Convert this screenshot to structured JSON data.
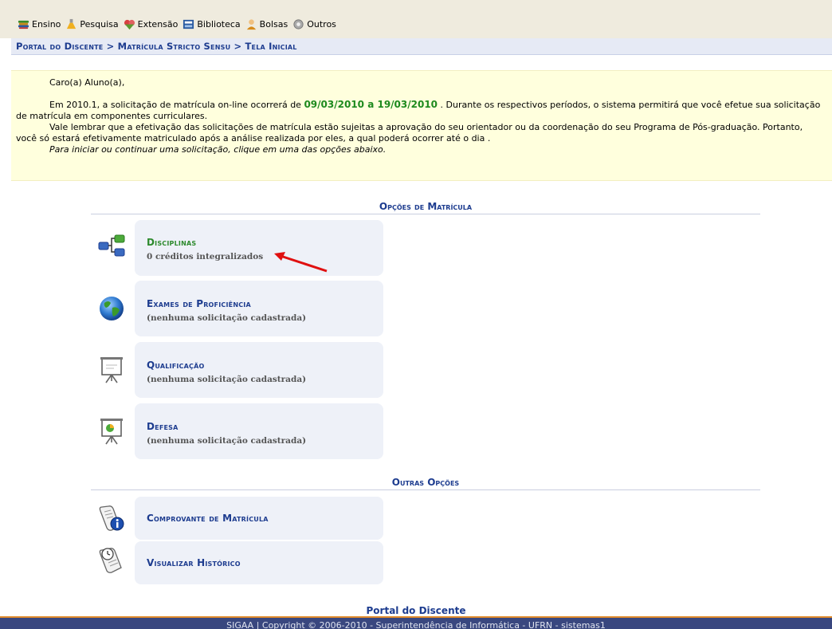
{
  "menu": {
    "items": [
      {
        "label": "Ensino",
        "icon": "books-icon",
        "color": "#c98a1a"
      },
      {
        "label": "Pesquisa",
        "icon": "flask-icon",
        "color": "#e0a020"
      },
      {
        "label": "Extensão",
        "icon": "puzzle-icon",
        "color": "#d84040"
      },
      {
        "label": "Biblioteca",
        "icon": "library-book-icon",
        "color": "#2a5aa0"
      },
      {
        "label": "Bolsas",
        "icon": "user-icon",
        "color": "#d68a1a"
      },
      {
        "label": "Outros",
        "icon": "gear-icon",
        "color": "#888888"
      }
    ]
  },
  "breadcrumb": "Portal do Discente > Matrícula Stricto Sensu > Tela Inicial",
  "notice": {
    "greeting": "Caro(a) Aluno(a),",
    "p1_before": "Em 2010.1, a solicitação de matrícula on-line ocorrerá de ",
    "p1_dates": "09/03/2010 a 19/03/2010",
    "p1_after": " . Durante os respectivos períodos, o sistema permitirá que você efetue sua solicitação de matrícula em componentes curriculares.",
    "p2": "Vale lembrar que a efetivação das solicitações de matrícula estão sujeitas a aprovação do seu orientador ou da coordenação do seu Programa de Pós-graduação. Portanto, você só estará efetivamente matriculado após a análise realizada por eles, a qual poderá ocorrer até o dia .",
    "p3": "Para iniciar ou continuar uma solicitação, clique em uma das opções abaixo."
  },
  "sections": {
    "matricula": "Opções de Matrícula",
    "outras": "Outras Opções"
  },
  "options": {
    "disciplinas": {
      "title": "Disciplinas",
      "subtitle": "0 créditos integralizados",
      "icon": "network-icon"
    },
    "exames": {
      "title": "Exames de Proficiência",
      "subtitle": "(nenhuma solicitação cadastrada)",
      "icon": "globe-icon"
    },
    "qualificacao": {
      "title": "Qualificação",
      "subtitle": "(nenhuma solicitação cadastrada)",
      "icon": "presentation-board-icon"
    },
    "defesa": {
      "title": "Defesa",
      "subtitle": "(nenhuma solicitação cadastrada)",
      "icon": "presentation-chart-icon"
    },
    "comprovante": {
      "title": "Comprovante de Matrícula",
      "icon": "scroll-info-icon"
    },
    "historico": {
      "title": "Visualizar Histórico",
      "icon": "scroll-clock-icon"
    }
  },
  "footer": {
    "title": "Portal do Discente",
    "copyright": "SIGAA | Copyright © 2006-2010 - Superintendência de Informática - UFRN - sistemas1"
  },
  "colors": {
    "link_blue": "#1d3c8f",
    "highlight_green": "#2d8a2d",
    "notice_bg": "#ffffdd",
    "annotation_arrow": "#e01010"
  }
}
